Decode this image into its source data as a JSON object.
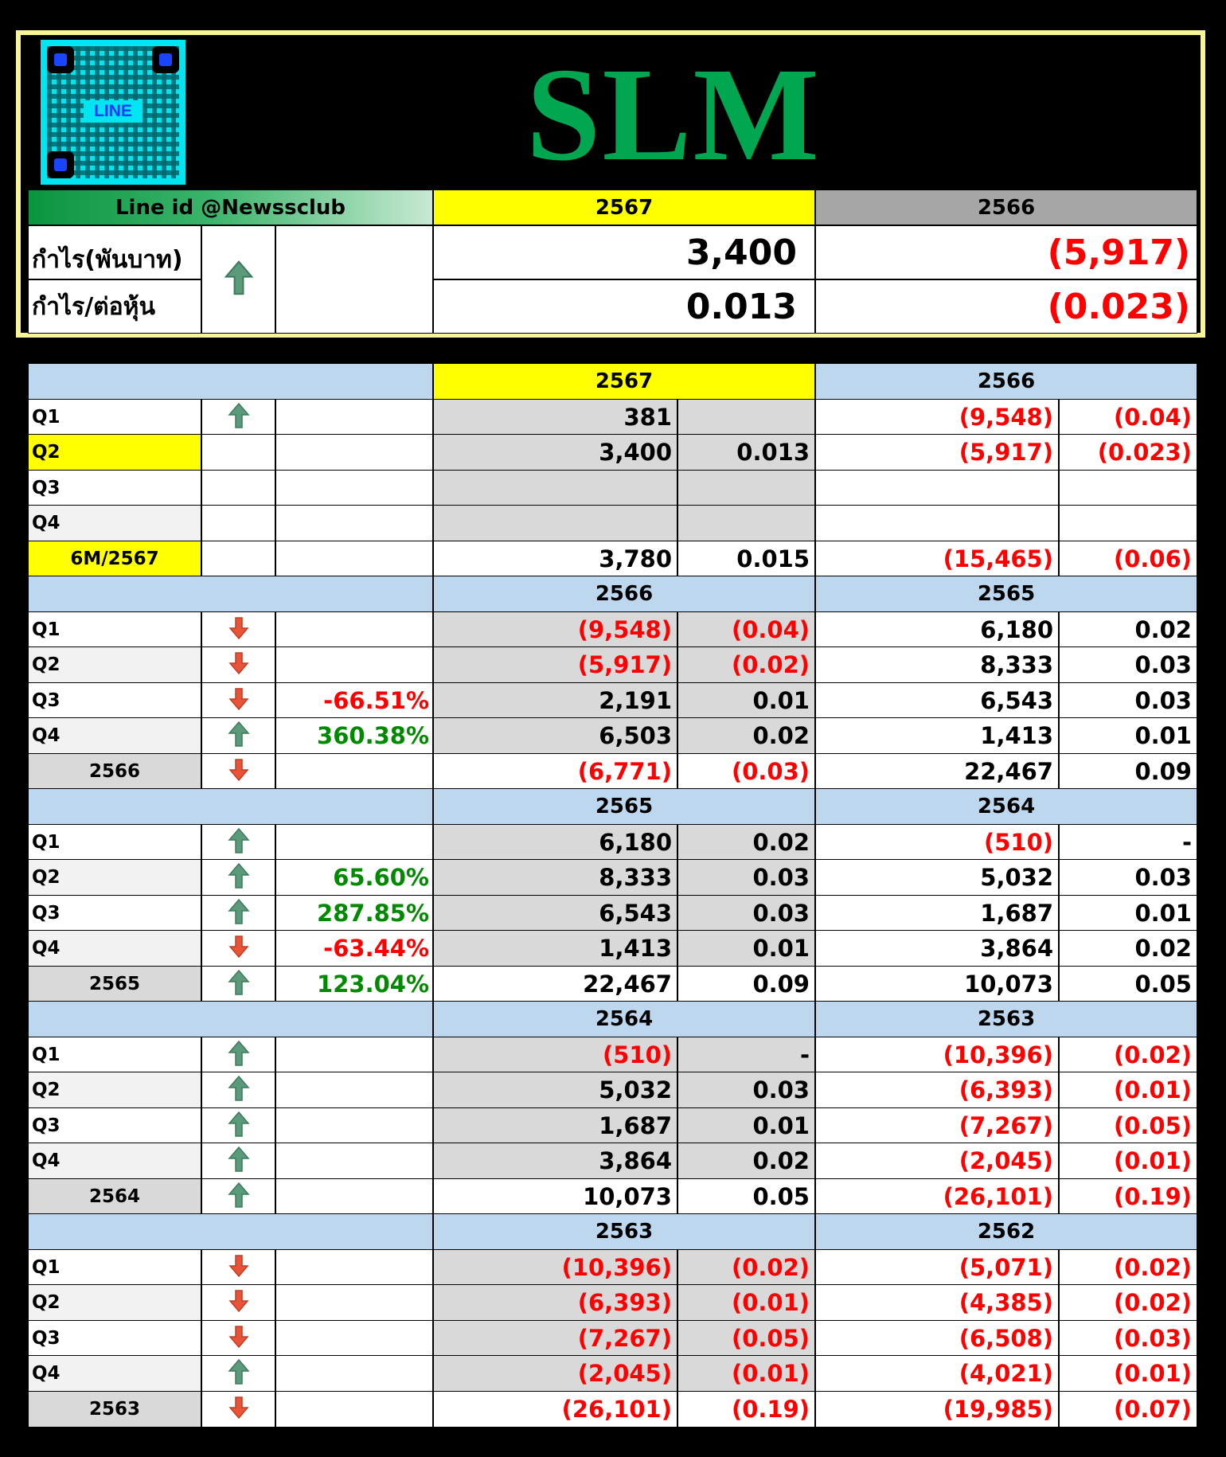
{
  "header": {
    "qr_label": "LINE",
    "title": "SLM",
    "line_id": "Line id @Newssclub",
    "year_current": "2567",
    "year_previous": "2566",
    "profit_label": "กำไร(พันบาท)",
    "eps_label": "กำไร/ต่อหุ้น",
    "trend": "up-arrow-icon",
    "profit_current": "3,400",
    "profit_previous": "(5,917)",
    "eps_current": "0.013",
    "eps_previous": "(0.023)"
  },
  "sections": [
    {
      "year_current": "2567",
      "year_previous": "2566",
      "current_year_highlight": true,
      "rows": [
        {
          "label": "Q1",
          "trend": "up",
          "change": "",
          "profit_cur": "381",
          "eps_cur": "",
          "profit_prev": "(9,548)",
          "eps_prev": "(0.04)"
        },
        {
          "label": "Q2",
          "trend": "",
          "change": "",
          "profit_cur": "3,400",
          "eps_cur": "0.013",
          "profit_prev": "(5,917)",
          "eps_prev": "(0.023)",
          "highlight": true
        },
        {
          "label": "Q3",
          "trend": "",
          "change": "",
          "profit_cur": "",
          "eps_cur": "",
          "profit_prev": "",
          "eps_prev": ""
        },
        {
          "label": "Q4",
          "trend": "",
          "change": "",
          "profit_cur": "",
          "eps_cur": "",
          "profit_prev": "",
          "eps_prev": ""
        }
      ],
      "total": {
        "label": "6M/2567",
        "trend": "",
        "change": "",
        "profit_cur": "3,780",
        "eps_cur": "0.015",
        "profit_prev": "(15,465)",
        "eps_prev": "(0.06)",
        "highlight": true
      }
    },
    {
      "year_current": "2566",
      "year_previous": "2565",
      "rows": [
        {
          "label": "Q1",
          "trend": "down",
          "change": "",
          "profit_cur": "(9,548)",
          "eps_cur": "(0.04)",
          "profit_prev": "6,180",
          "eps_prev": "0.02"
        },
        {
          "label": "Q2",
          "trend": "down",
          "change": "",
          "profit_cur": "(5,917)",
          "eps_cur": "(0.02)",
          "profit_prev": "8,333",
          "eps_prev": "0.03"
        },
        {
          "label": "Q3",
          "trend": "down",
          "change": "-66.51%",
          "profit_cur": "2,191",
          "eps_cur": "0.01",
          "profit_prev": "6,543",
          "eps_prev": "0.03"
        },
        {
          "label": "Q4",
          "trend": "up",
          "change": "360.38%",
          "profit_cur": "6,503",
          "eps_cur": "0.02",
          "profit_prev": "1,413",
          "eps_prev": "0.01"
        }
      ],
      "total": {
        "label": "2566",
        "trend": "down",
        "change": "",
        "profit_cur": "(6,771)",
        "eps_cur": "(0.03)",
        "profit_prev": "22,467",
        "eps_prev": "0.09"
      }
    },
    {
      "year_current": "2565",
      "year_previous": "2564",
      "rows": [
        {
          "label": "Q1",
          "trend": "up",
          "change": "",
          "profit_cur": "6,180",
          "eps_cur": "0.02",
          "profit_prev": "(510)",
          "eps_prev": "-"
        },
        {
          "label": "Q2",
          "trend": "up",
          "change": "65.60%",
          "profit_cur": "8,333",
          "eps_cur": "0.03",
          "profit_prev": "5,032",
          "eps_prev": "0.03"
        },
        {
          "label": "Q3",
          "trend": "up",
          "change": "287.85%",
          "profit_cur": "6,543",
          "eps_cur": "0.03",
          "profit_prev": "1,687",
          "eps_prev": "0.01"
        },
        {
          "label": "Q4",
          "trend": "down",
          "change": "-63.44%",
          "profit_cur": "1,413",
          "eps_cur": "0.01",
          "profit_prev": "3,864",
          "eps_prev": "0.02"
        }
      ],
      "total": {
        "label": "2565",
        "trend": "up",
        "change": "123.04%",
        "profit_cur": "22,467",
        "eps_cur": "0.09",
        "profit_prev": "10,073",
        "eps_prev": "0.05"
      }
    },
    {
      "year_current": "2564",
      "year_previous": "2563",
      "rows": [
        {
          "label": "Q1",
          "trend": "up",
          "change": "",
          "profit_cur": "(510)",
          "eps_cur": "-",
          "profit_prev": "(10,396)",
          "eps_prev": "(0.02)"
        },
        {
          "label": "Q2",
          "trend": "up",
          "change": "",
          "profit_cur": "5,032",
          "eps_cur": "0.03",
          "profit_prev": "(6,393)",
          "eps_prev": "(0.01)"
        },
        {
          "label": "Q3",
          "trend": "up",
          "change": "",
          "profit_cur": "1,687",
          "eps_cur": "0.01",
          "profit_prev": "(7,267)",
          "eps_prev": "(0.05)"
        },
        {
          "label": "Q4",
          "trend": "up",
          "change": "",
          "profit_cur": "3,864",
          "eps_cur": "0.02",
          "profit_prev": "(2,045)",
          "eps_prev": "(0.01)"
        }
      ],
      "total": {
        "label": "2564",
        "trend": "up",
        "change": "",
        "profit_cur": "10,073",
        "eps_cur": "0.05",
        "profit_prev": "(26,101)",
        "eps_prev": "(0.19)"
      }
    },
    {
      "year_current": "2563",
      "year_previous": "2562",
      "rows": [
        {
          "label": "Q1",
          "trend": "down",
          "change": "",
          "profit_cur": "(10,396)",
          "eps_cur": "(0.02)",
          "profit_prev": "(5,071)",
          "eps_prev": "(0.02)"
        },
        {
          "label": "Q2",
          "trend": "down",
          "change": "",
          "profit_cur": "(6,393)",
          "eps_cur": "(0.01)",
          "profit_prev": "(4,385)",
          "eps_prev": "(0.02)"
        },
        {
          "label": "Q3",
          "trend": "down",
          "change": "",
          "profit_cur": "(7,267)",
          "eps_cur": "(0.05)",
          "profit_prev": "(6,508)",
          "eps_prev": "(0.03)"
        },
        {
          "label": "Q4",
          "trend": "up",
          "change": "",
          "profit_cur": "(2,045)",
          "eps_cur": "(0.01)",
          "profit_prev": "(4,021)",
          "eps_prev": "(0.01)"
        }
      ],
      "total": {
        "label": "2563",
        "trend": "down",
        "change": "",
        "profit_cur": "(26,101)",
        "eps_cur": "(0.19)",
        "profit_prev": "(19,985)",
        "eps_prev": "(0.07)"
      }
    }
  ],
  "colors": {
    "title_green": "#00a650",
    "negative_red": "#ff0000",
    "positive_green": "#008a00",
    "highlight_yellow": "#ffff00",
    "section_blue": "#bdd7ee",
    "panel_border": "#f8f598",
    "arrow_up": "#5b9a7a",
    "arrow_down": "#e8543a"
  }
}
